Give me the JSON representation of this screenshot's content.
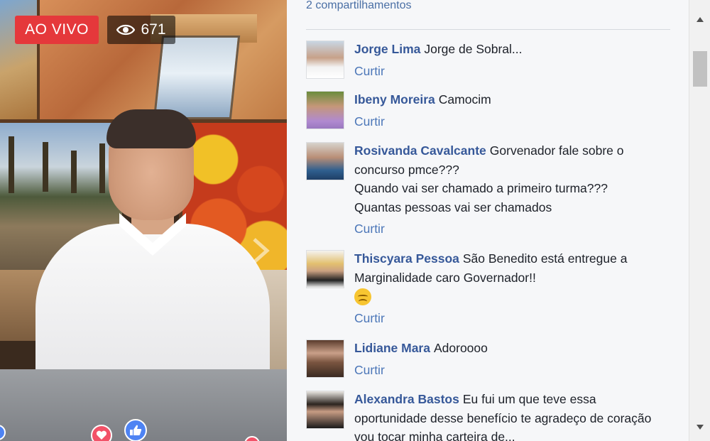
{
  "video": {
    "live_label": "AO VIVO",
    "view_count": "671",
    "icons": [
      "eye-icon",
      "chevron-right-icon",
      "love-icon",
      "like-icon"
    ],
    "colors": {
      "live_badge": "#e5383b",
      "love": "#f25268",
      "like": "#4e83f3"
    }
  },
  "comments_panel": {
    "shares_text": "2 compartilhamentos",
    "like_label": "Curtir",
    "items": [
      {
        "name": "Jorge Lima",
        "text": "Jorge de Sobral..."
      },
      {
        "name": "Ibeny Moreira",
        "text": "Camocim"
      },
      {
        "name": "Rosivanda Cavalcante",
        "text": "Gorvenador fale sobre o concurso pmce???",
        "line2": "Quando vai ser chamado a primeiro turma???",
        "line3": "Quantas pessoas vai ser chamados"
      },
      {
        "name": "Thiscyara Pessoa",
        "text": "São Benedito está entregue a Marginalidade caro Governador!!",
        "emoji": "disappointed-face-emoji"
      },
      {
        "name": "Lidiane Mara",
        "text": "Adoroooo"
      },
      {
        "name": "Alexandra Bastos",
        "text": "Eu fui um que teve essa oportunidade desse benefício te agradeço de coração vou tocar minha carteira de..."
      }
    ],
    "colors": {
      "name": "#365899",
      "link": "#4b76b8",
      "text": "#1d2129",
      "background": "#f6f7f9"
    }
  }
}
